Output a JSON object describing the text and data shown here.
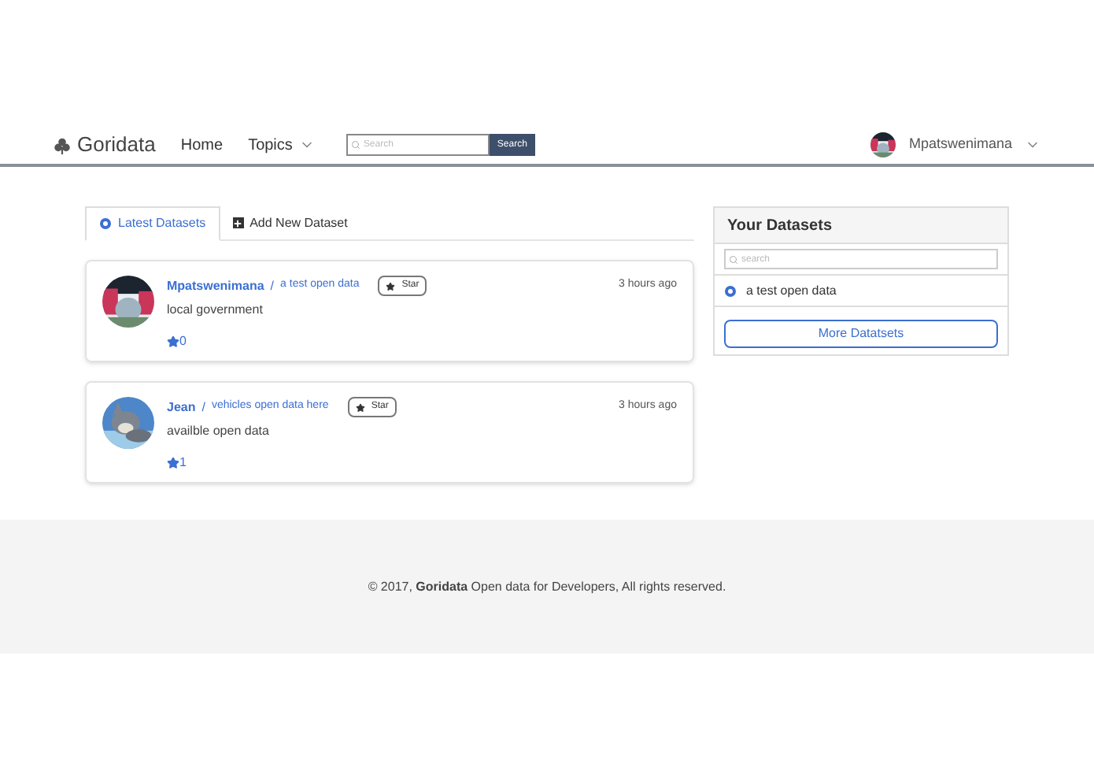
{
  "navbar": {
    "brand": "Goridata",
    "links": [
      {
        "label": "Home",
        "kind": "link"
      },
      {
        "label": "Topics",
        "kind": "dropdown"
      }
    ],
    "search": {
      "placeholder": "Search",
      "button": "Search"
    },
    "user": {
      "name": "Mpatswenimana"
    }
  },
  "tabs": [
    {
      "label": "Latest Datasets",
      "selected": true
    },
    {
      "label": "Add New Dataset",
      "selected": false
    }
  ],
  "datasets": [
    {
      "owner": "Mpatswenimana",
      "separator": "/",
      "title": "a test open data",
      "star_button": "Star",
      "time": "3 hours ago",
      "description": "local government",
      "stars": "0"
    },
    {
      "owner": "Jean",
      "separator": "/",
      "title": "vehicles open data here",
      "star_button": "Star",
      "time": "3 hours ago",
      "description": "availble open data",
      "stars": "1"
    }
  ],
  "your_datasets": {
    "title": "Your Datasets",
    "search": {
      "placeholder": "search"
    },
    "items": [
      "a test open data"
    ],
    "button": "More Datatsets"
  },
  "footer": {
    "text": "© 2017, **Goridata** Open data for Developers, All rights reserved."
  }
}
